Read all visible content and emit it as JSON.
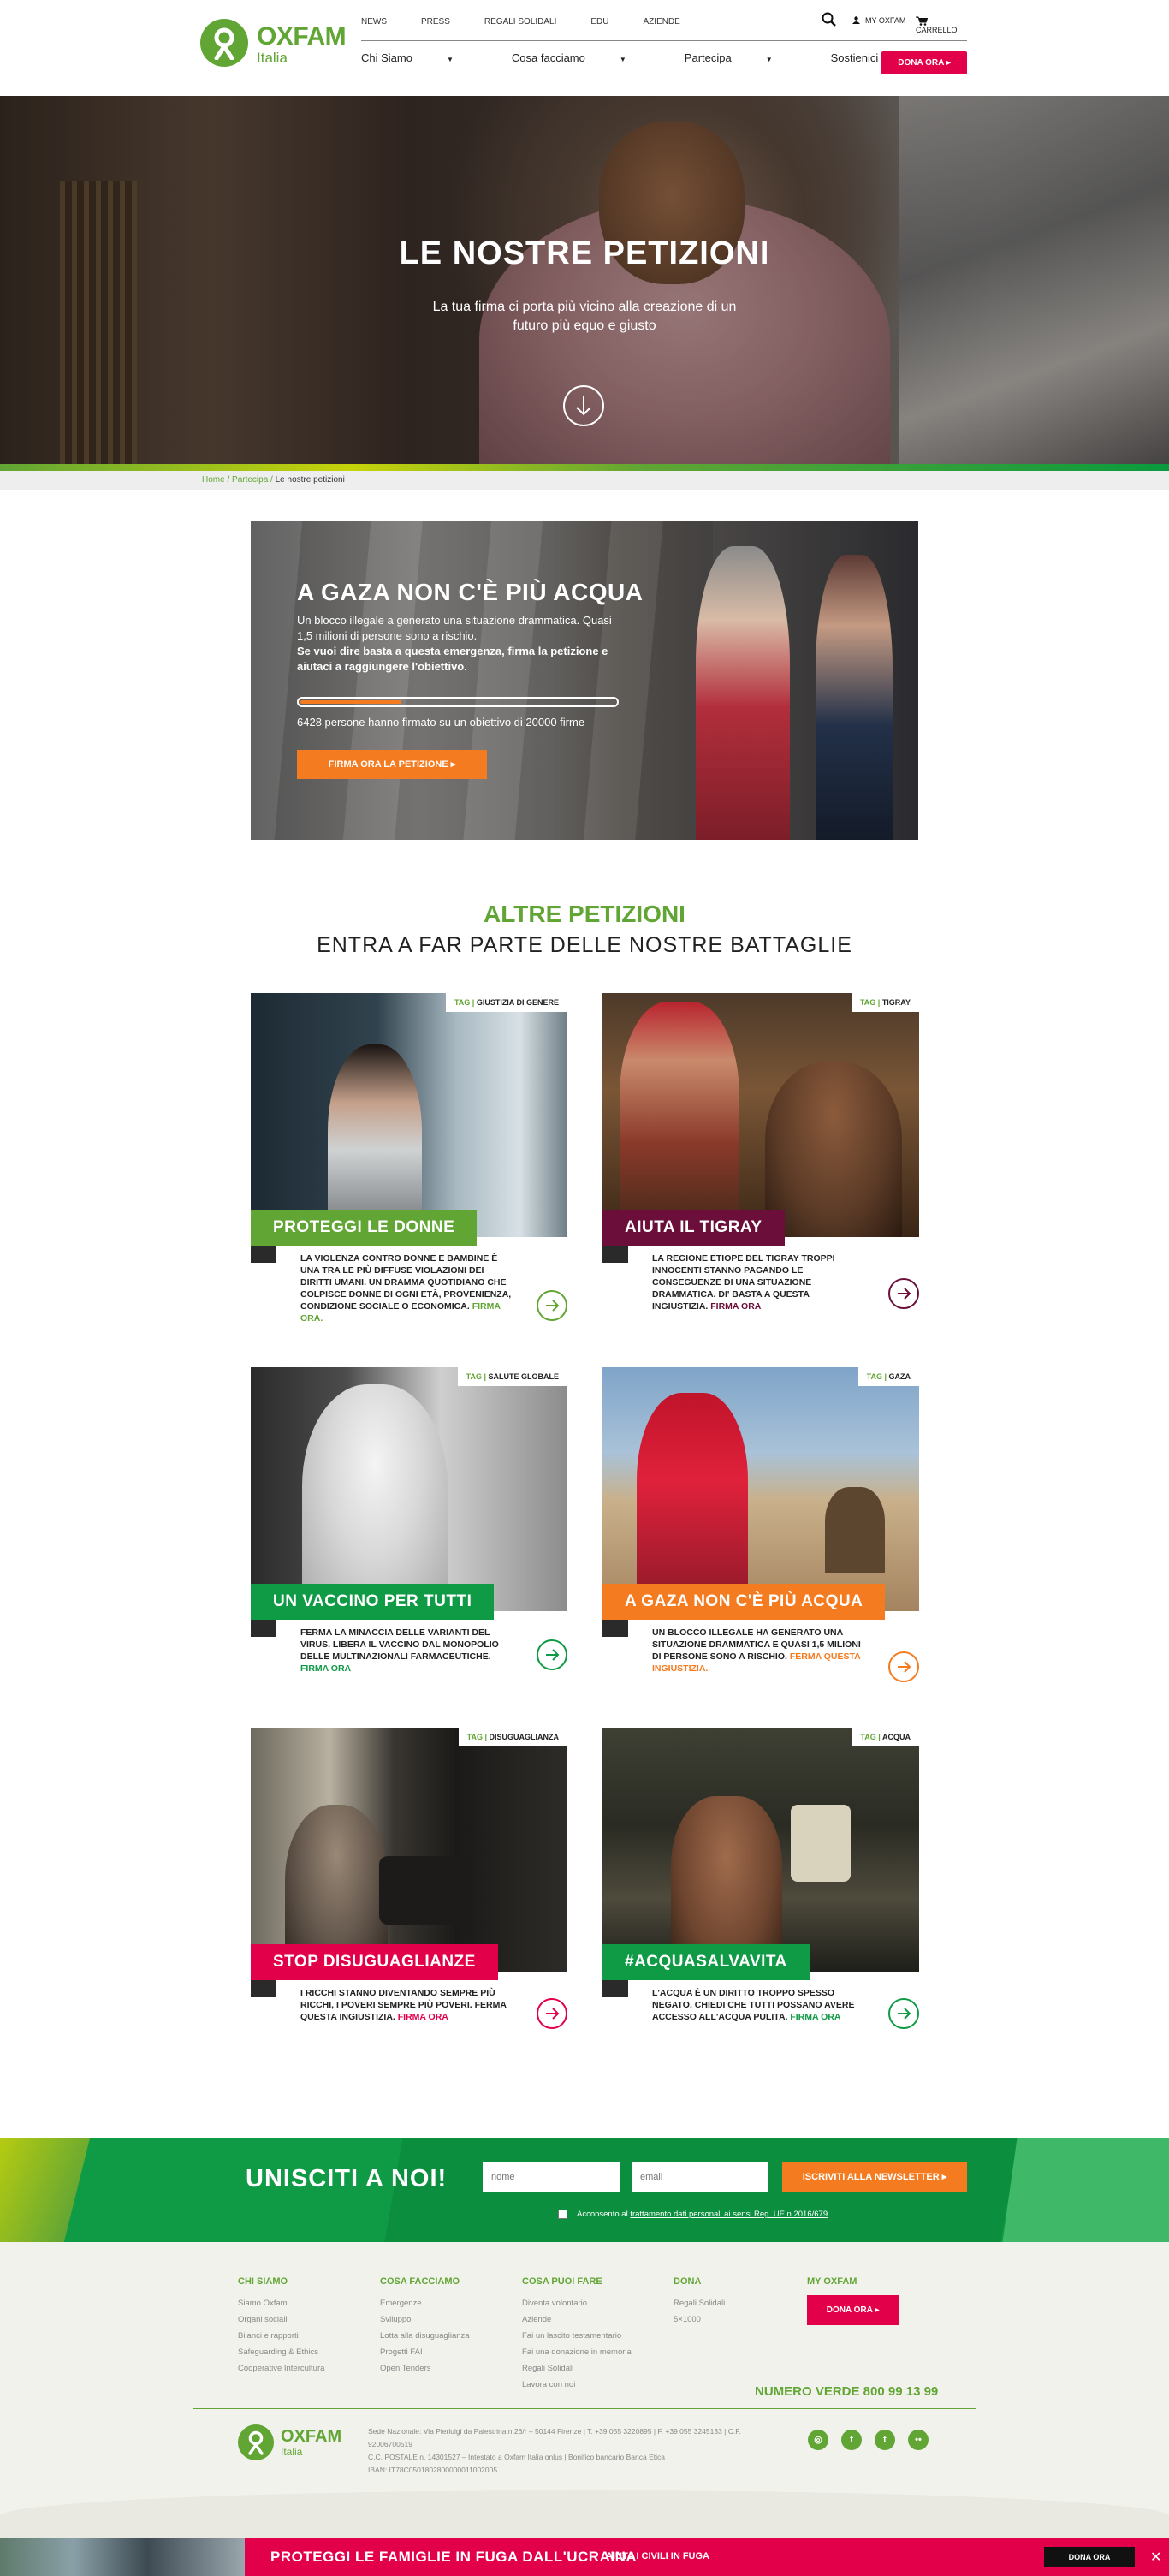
{
  "header": {
    "logo_text": "OXFAM",
    "logo_sub": "Italia",
    "top_nav": [
      "NEWS",
      "PRESS",
      "REGALI SOLIDALI",
      "EDU",
      "AZIENDE"
    ],
    "my_oxfam": "MY OXFAM",
    "cart": "CARRELLO",
    "main_nav": [
      "Chi Siamo",
      "Cosa facciamo",
      "Partecipa",
      "Sostienici"
    ],
    "donate": "DONA ORA ▸"
  },
  "hero": {
    "title": "LE NOSTRE PETIZIONI",
    "subtitle": "La tua firma ci porta più vicino alla creazione di un futuro più equo e giusto"
  },
  "breadcrumb": {
    "home": "Home",
    "sep1": " / ",
    "parent": "Partecipa",
    "sep2": " / ",
    "current": "Le nostre petizioni"
  },
  "featured": {
    "title": "A GAZA NON C'È PIÙ ACQUA",
    "desc": "Un blocco illegale a generato una situazione drammatica. Quasi 1,5 milioni di persone sono a rischio.",
    "desc_bold": "Se vuoi dire basta a questa emergenza, firma la petizione e aiutaci a raggiungere l'obiettivo.",
    "progress_fraction": 0.3214,
    "count_text": "6428 persone hanno firmato su un obiettivo di 20000 firme",
    "button": "FIRMA ORA LA PETIZIONE  ▸"
  },
  "section": {
    "title": "ALTRE PETIZIONI",
    "subtitle": "ENTRA A FAR PARTE DELLE NOSTRE BATTAGLIE"
  },
  "cards": [
    {
      "tag_label": "TAG |",
      "tag": "GIUSTIZIA DI GENERE",
      "title": "PROTEGGI LE DONNE",
      "text": "LA VIOLENZA CONTRO DONNE E BAMBINE È UNA TRA LE PIÙ DIFFUSE VIOLAZIONI DEI DIRITTI UMANI. UN DRAMMA QUOTIDIANO CHE COLPISCE DONNE DI OGNI ETÀ, PROVENIENZA, CONDIZIONE SOCIALE O ECONOMICA.",
      "cta": "FIRMA ORA.",
      "color": "#61a534"
    },
    {
      "tag_label": "TAG |",
      "tag": "TIGRAY",
      "title": "AIUTA IL TIGRAY",
      "text": "LA REGIONE ETIOPE DEL TIGRAY TROPPI INNOCENTI STANNO PAGANDO LE CONSEGUENZE DI UNA SITUAZIONE DRAMMATICA. DI' BASTA A QUESTA INGIUSTIZIA.",
      "cta": "FIRMA ORA",
      "color": "#6b0f3a"
    },
    {
      "tag_label": "TAG |",
      "tag": "SALUTE GLOBALE",
      "title": "UN VACCINO PER TUTTI",
      "text": "FERMA LA MINACCIA DELLE VARIANTI DEL VIRUS. LIBERA IL VACCINO DAL MONOPOLIO DELLE MULTINAZIONALI FARMACEUTICHE.",
      "cta": "FIRMA ORA",
      "color": "#0f9a45"
    },
    {
      "tag_label": "TAG |",
      "tag": "GAZA",
      "title": "A GAZA NON C'È PIÙ ACQUA",
      "text": "UN BLOCCO ILLEGALE HA GENERATO UNA SITUAZIONE DRAMMATICA E QUASI 1,5 MILIONI DI PERSONE SONO A RISCHIO.",
      "cta": "FERMA QUESTA INGIUSTIZIA.",
      "color": "#f47b20"
    },
    {
      "tag_label": "TAG |",
      "tag": "DISUGUAGLIANZA",
      "title": "STOP DISUGUAGLIANZE",
      "text": "I RICCHI STANNO DIVENTANDO SEMPRE PIÙ RICCHI, I POVERI SEMPRE PIÙ POVERI. FERMA QUESTA INGIUSTIZIA.",
      "cta": "FIRMA ORA",
      "color": "#e2004b"
    },
    {
      "tag_label": "TAG |",
      "tag": "ACQUA",
      "title": "#ACQUASALVAVITA",
      "text": "L'ACQUA È UN DIRITTO TROPPO SPESSO NEGATO. CHIEDI CHE TUTTI POSSANO AVERE ACCESSO ALL'ACQUA PULITA.",
      "cta": "FIRMA ORA",
      "color": "#0f9a45"
    }
  ],
  "newsletter": {
    "title": "UNISCITI A NOI!",
    "name_placeholder": "nome",
    "email_placeholder": "email",
    "button": "ISCRIVITI ALLA NEWSLETTER ▸",
    "consent_prefix": "Acconsento al",
    "consent_link": "trattamento dati personali ai sensi Reg. UE n.2016/679"
  },
  "footer": {
    "columns": [
      {
        "heading": "CHI SIAMO",
        "items": [
          "Siamo Oxfam",
          "Organi sociali",
          "Bilanci e rapporti",
          "Safeguarding & Ethics",
          "Cooperative Intercultura"
        ]
      },
      {
        "heading": "COSA FACCIAMO",
        "items": [
          "Emergenze",
          "Sviluppo",
          "Lotta alla disuguaglianza",
          "Progetti FAI",
          "Open Tenders"
        ]
      },
      {
        "heading": "COSA PUOI FARE",
        "items": [
          "Diventa volontario",
          "Aziende",
          "Fai un lascito testamentario",
          "Fai una donazione in memoria",
          "Regali Solidali",
          "Lavora con noi"
        ]
      },
      {
        "heading": "DONA",
        "items": [
          "Regali Solidali",
          "5×1000"
        ]
      },
      {
        "heading": "MY OXFAM",
        "items": []
      }
    ],
    "donate": "DONA ORA  ▸",
    "numero_verde": "NUMERO VERDE 800 99 13 99",
    "logo_text": "OXFAM",
    "logo_sub": "Italia",
    "legal_1": "Sede Nazionale: Via Pierluigi da Palestrina n.26/r – 50144 Firenze | T. +39 055 3220895 | F. +39 055 3245133 | C.F. 92006700519",
    "legal_2": "C.C. POSTALE n. 14301527 – Intestato a Oxfam Italia onlus | Bonifico bancario Banca Etica",
    "legal_3": "IBAN: IT78C0501802800000011002005",
    "social": [
      "instagram-icon",
      "facebook-icon",
      "twitter-icon",
      "flickr-icon"
    ]
  },
  "banner": {
    "title": "PROTEGGI LE FAMIGLIE IN FUGA DALL'UCRAINA",
    "subtitle": "AIUTA I CIVILI IN FUGA",
    "button": "DONA ORA",
    "close": "✕"
  }
}
